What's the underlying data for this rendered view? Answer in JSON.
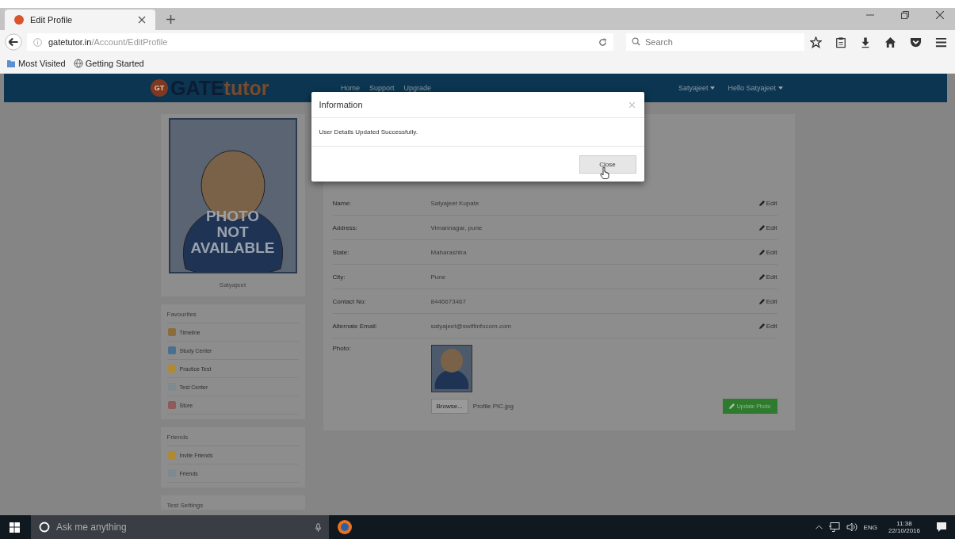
{
  "browser": {
    "tab": {
      "title": "Edit Profile"
    },
    "url": {
      "host": "gatetutor.in",
      "path": "/Account/EditProfile"
    },
    "search": {
      "placeholder": "Search"
    },
    "bookmarks": [
      "Most Visited",
      "Getting Started"
    ]
  },
  "site": {
    "logo": {
      "badge": "GT",
      "part1": "GATE",
      "part2": "tutor"
    },
    "nav": [
      "Home",
      "Support",
      "Upgrade"
    ],
    "user_menus": [
      "Satyajeet",
      "Hello Satyajeet"
    ]
  },
  "sidebar": {
    "photo_text": [
      "PHOTO",
      "NOT",
      "AVAILABLE"
    ],
    "user_name": "Satyajeet",
    "sections": [
      {
        "title": "Favourites",
        "items": [
          "Timeline",
          "Study Center",
          "Practice Test",
          "Test Center",
          "Store"
        ]
      },
      {
        "title": "Friends",
        "items": [
          "Invite Friends",
          "Friends"
        ]
      },
      {
        "title": "Test Settings"
      }
    ]
  },
  "profile": {
    "rows": [
      {
        "label": "Name:",
        "value": "Satyajeet Kupate",
        "edit": "Edit"
      },
      {
        "label": "Address:",
        "value": "Vimannagar, pune",
        "edit": "Edit"
      },
      {
        "label": "State:",
        "value": "Maharashtra",
        "edit": "Edit"
      },
      {
        "label": "City:",
        "value": "Pune",
        "edit": "Edit"
      },
      {
        "label": "Contact No:",
        "value": "8446673467",
        "edit": "Edit"
      },
      {
        "label": "Alternate Email:",
        "value": "satyajeet@swiftinfocom.com",
        "edit": "Edit"
      }
    ],
    "photo": {
      "label": "Photo:",
      "browse": "Browse...",
      "file": "Profile PIC.jpg",
      "button": "Update Photo"
    }
  },
  "modal": {
    "title": "Information",
    "message": "User Details Updated Successfully.",
    "button": "Close"
  },
  "taskbar": {
    "search": "Ask me anything",
    "language": "ENG",
    "time": "11:38",
    "date": "22/10/2016"
  }
}
